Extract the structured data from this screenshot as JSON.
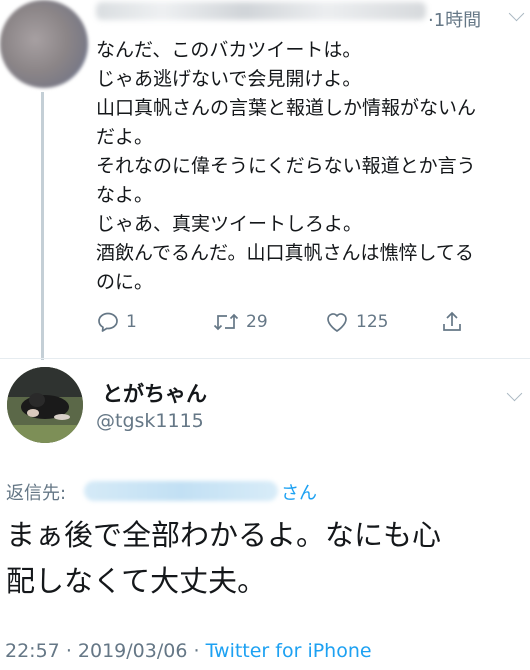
{
  "reply_tweet": {
    "time_ago": "·1時間",
    "body_lines": [
      "なんだ、このバカツイートは。",
      "じゃあ逃げないで会見開けよ。",
      "山口真帆さんの言葉と報道しか情報がないん",
      "だよ。",
      "それなのに偉そうにくだらない報道とか言う",
      "なよ。",
      "じゃあ、真実ツイートしろよ。",
      "酒飲んでるんだ。山口真帆さんは憔悴してる",
      "のに。"
    ],
    "actions": {
      "reply_count": "1",
      "retweet_count": "29",
      "like_count": "125"
    }
  },
  "main_tweet": {
    "display_name": "とがちゃん",
    "handle": "@tgsk1115",
    "reply_to_label": "返信先:",
    "reply_to_suffix": "さん",
    "body_lines": [
      "まぁ後で全部わかるよ。なにも心",
      "配しなくて大丈夫。"
    ],
    "time": "22:57",
    "date": "2019/03/06",
    "source": "Twitter for iPhone"
  },
  "colors": {
    "text": "#14171a",
    "secondary": "#657786",
    "link": "#1da1f2",
    "thread_line": "#c4cfd6"
  },
  "icons": [
    "reply-icon",
    "retweet-icon",
    "like-icon",
    "share-icon",
    "chevron-down-icon"
  ]
}
